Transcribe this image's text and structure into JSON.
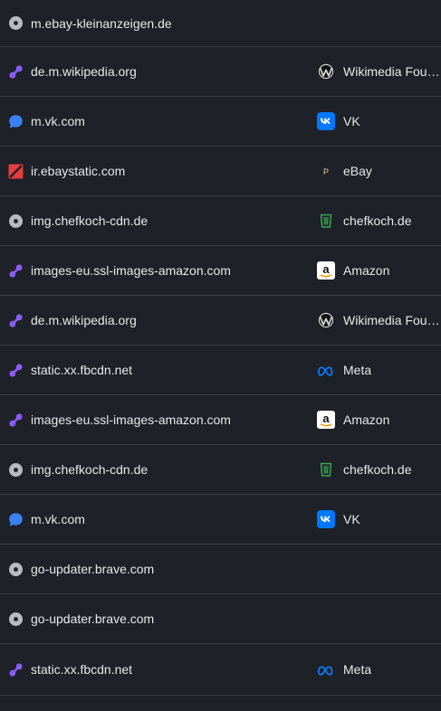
{
  "rows": [
    {
      "domain": "m.ebay-kleinanzeigen.de",
      "domain_icon": "disc-gray-icon",
      "org": "",
      "org_icon": ""
    },
    {
      "domain": "de.m.wikipedia.org",
      "domain_icon": "link-purple-icon",
      "org": "Wikimedia Fou…",
      "org_icon": "wikimedia-icon"
    },
    {
      "domain": "m.vk.com",
      "domain_icon": "chat-blue-icon",
      "org": "VK",
      "org_icon": "vk-icon"
    },
    {
      "domain": "ir.ebaystatic.com",
      "domain_icon": "slash-red-icon",
      "org": "eBay",
      "org_icon": "ebay-icon"
    },
    {
      "domain": "img.chefkoch-cdn.de",
      "domain_icon": "disc-gray-icon",
      "org": "chefkoch.de",
      "org_icon": "chefkoch-icon"
    },
    {
      "domain": "images-eu.ssl-images-amazon.com",
      "domain_icon": "link-purple-icon",
      "org": "Amazon",
      "org_icon": "amazon-icon"
    },
    {
      "domain": "de.m.wikipedia.org",
      "domain_icon": "link-purple-icon",
      "org": "Wikimedia Fou…",
      "org_icon": "wikimedia-icon"
    },
    {
      "domain": "static.xx.fbcdn.net",
      "domain_icon": "link-purple-icon",
      "org": "Meta",
      "org_icon": "meta-icon"
    },
    {
      "domain": "images-eu.ssl-images-amazon.com",
      "domain_icon": "link-purple-icon",
      "org": "Amazon",
      "org_icon": "amazon-icon"
    },
    {
      "domain": "img.chefkoch-cdn.de",
      "domain_icon": "disc-gray-icon",
      "org": "chefkoch.de",
      "org_icon": "chefkoch-icon"
    },
    {
      "domain": "m.vk.com",
      "domain_icon": "chat-blue-icon",
      "org": "VK",
      "org_icon": "vk-icon"
    },
    {
      "domain": "go-updater.brave.com",
      "domain_icon": "disc-gray-icon",
      "org": "",
      "org_icon": ""
    },
    {
      "domain": "go-updater.brave.com",
      "domain_icon": "disc-gray-icon",
      "org": "",
      "org_icon": ""
    },
    {
      "domain": "static.xx.fbcdn.net",
      "domain_icon": "link-purple-icon",
      "org": "Meta",
      "org_icon": "meta-icon"
    }
  ],
  "colors": {
    "background": "#1e2127",
    "divider": "#3a3e45",
    "text": "#e6e8ea",
    "purple": "#8b5cf6",
    "blue": "#3b82f6",
    "red": "#e53e3e",
    "gray": "#b8bcc2",
    "vk": "#0077ff",
    "chefkoch": "#3aa655",
    "amazon_orange": "#ff9900"
  }
}
